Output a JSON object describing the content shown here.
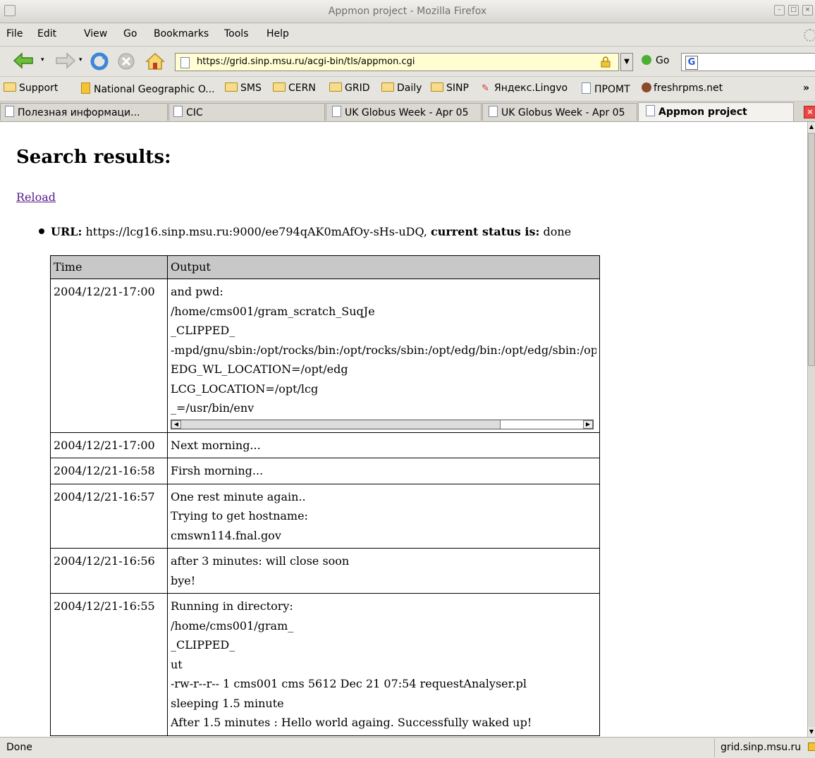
{
  "window": {
    "title": "Appmon project - Mozilla Firefox"
  },
  "menu": [
    "File",
    "Edit",
    "View",
    "Go",
    "Bookmarks",
    "Tools",
    "Help"
  ],
  "nav": {
    "url": "https://grid.sinp.msu.ru/acgi-bin/tls/appmon.cgi",
    "go_label": "Go"
  },
  "bookmarks": [
    "Support",
    "National Geographic O...",
    "SMS",
    "CERN",
    "GRID",
    "Daily",
    "SINP",
    "Яндекс.Lingvo",
    "ПРОМТ",
    "freshrpms.net"
  ],
  "bookmarks_more": "»",
  "tabs": [
    "Полезная информаци...",
    "CIC",
    "UK Globus Week - Apr 05",
    "UK Globus Week - Apr 05",
    "Appmon project"
  ],
  "page": {
    "heading": "Search results:",
    "reload_link": "Reload",
    "url_label": "URL:",
    "url_value": "https://lcg16.sinp.msu.ru:9000/ee794qAK0mAfOy-sHs-uDQ,",
    "status_label": "current status is:",
    "status_value": "done"
  },
  "table": {
    "headers": [
      "Time",
      "Output"
    ],
    "rows": [
      {
        "time": "2004/12/21-17:00",
        "lines": [
          "and pwd:",
          "/home/cms001/gram_scratch_SuqJe",
          "_CLIPPED_",
          "-mpd/gnu/sbin:/opt/rocks/bin:/opt/rocks/sbin:/opt/edg/bin:/opt/edg/sbin:/opt/edg/",
          "EDG_WL_LOCATION=/opt/edg",
          "LCG_LOCATION=/opt/lcg",
          "_=/usr/bin/env"
        ]
      },
      {
        "time": "2004/12/21-17:00",
        "lines": [
          "Next morning..."
        ]
      },
      {
        "time": "2004/12/21-16:58",
        "lines": [
          "Firsh morning..."
        ]
      },
      {
        "time": "2004/12/21-16:57",
        "lines": [
          "One rest minute again..",
          "Trying to get hostname:",
          "cmswn114.fnal.gov"
        ]
      },
      {
        "time": "2004/12/21-16:56",
        "lines": [
          "after 3 minutes: will close soon",
          "bye!"
        ]
      },
      {
        "time": "2004/12/21-16:55",
        "lines": [
          "Running in directory:",
          "/home/cms001/gram_",
          "_CLIPPED_",
          "ut",
          "-rw-r--r-- 1 cms001 cms 5612 Dec 21 07:54 requestAnalyser.pl",
          "sleeping 1.5 minute",
          "After 1.5 minutes : Hello world againg. Successfully waked up!"
        ]
      }
    ]
  },
  "status": {
    "left": "Done",
    "right": "grid.sinp.msu.ru"
  },
  "colors": {
    "url_bg": "#fffdd1",
    "header_bg": "#c8c8c8",
    "visited_link": "#551a8b"
  }
}
